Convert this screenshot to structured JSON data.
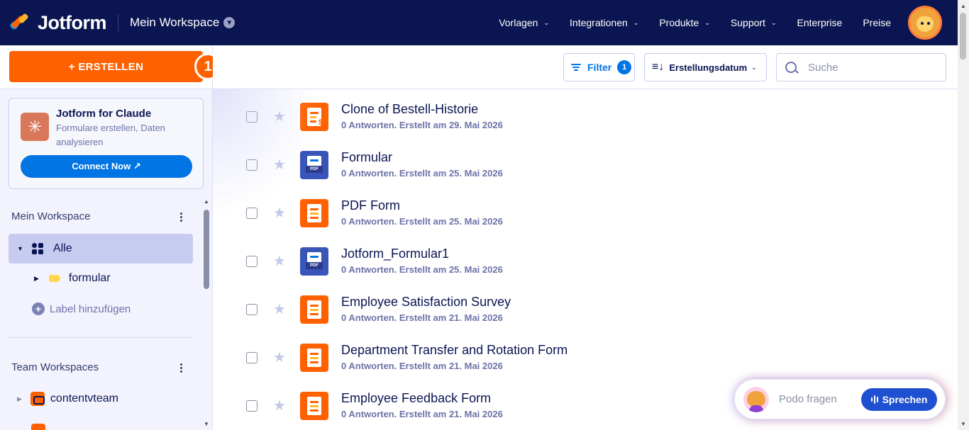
{
  "header": {
    "brand": "Jotform",
    "workspace": "Mein Workspace",
    "nav": [
      {
        "label": "Vorlagen",
        "dropdown": true
      },
      {
        "label": "Integrationen",
        "dropdown": true
      },
      {
        "label": "Produkte",
        "dropdown": true
      },
      {
        "label": "Support",
        "dropdown": true
      },
      {
        "label": "Enterprise",
        "dropdown": false
      },
      {
        "label": "Preise",
        "dropdown": false
      }
    ]
  },
  "sidebar": {
    "create_label": "+ ERSTELLEN",
    "step_badge": "1",
    "promo": {
      "title": "Jotform for Claude",
      "description": "Formulare erstellen, Daten analysieren",
      "button": "Connect Now ↗"
    },
    "my_workspace_title": "Mein Workspace",
    "all_label": "Alle",
    "folder_label": "formular",
    "add_label": "Label hinzufügen",
    "team_title": "Team Workspaces",
    "team_item": "contentvteam"
  },
  "toolbar": {
    "filter_label": "Filter",
    "filter_count": "1",
    "sort_label": "Erstellungsdatum",
    "search_placeholder": "Suche"
  },
  "forms": [
    {
      "title": "Clone of Bestell-Historie",
      "meta": "0 Antworten. Erstellt am 29. Mai 2026",
      "icon": "orange-form-payment-icon"
    },
    {
      "title": "Formular",
      "meta": "0 Antworten. Erstellt am 25. Mai 2026",
      "icon": "blue-pdf-icon"
    },
    {
      "title": "PDF Form",
      "meta": "0 Antworten. Erstellt am 25. Mai 2026",
      "icon": "orange-form-icon"
    },
    {
      "title": "Jotform_Formular1",
      "meta": "0 Antworten. Erstellt am 25. Mai 2026",
      "icon": "blue-pdf-icon"
    },
    {
      "title": "Employee Satisfaction Survey",
      "meta": "0 Antworten. Erstellt am 21. Mai 2026",
      "icon": "orange-form-icon"
    },
    {
      "title": "Department Transfer and Rotation Form",
      "meta": "0 Antworten. Erstellt am 21. Mai 2026",
      "icon": "orange-form-icon"
    },
    {
      "title": "Employee Feedback Form",
      "meta": "0 Antworten. Erstellt am 21. Mai 2026",
      "icon": "orange-form-icon"
    }
  ],
  "podo": {
    "placeholder": "Podo fragen",
    "speak_label": "Sprechen"
  },
  "colors": {
    "header_bg": "#0a1551",
    "accent_orange": "#ff6100",
    "accent_blue": "#0075e3",
    "sidebar_bg": "#f3f3fe"
  }
}
